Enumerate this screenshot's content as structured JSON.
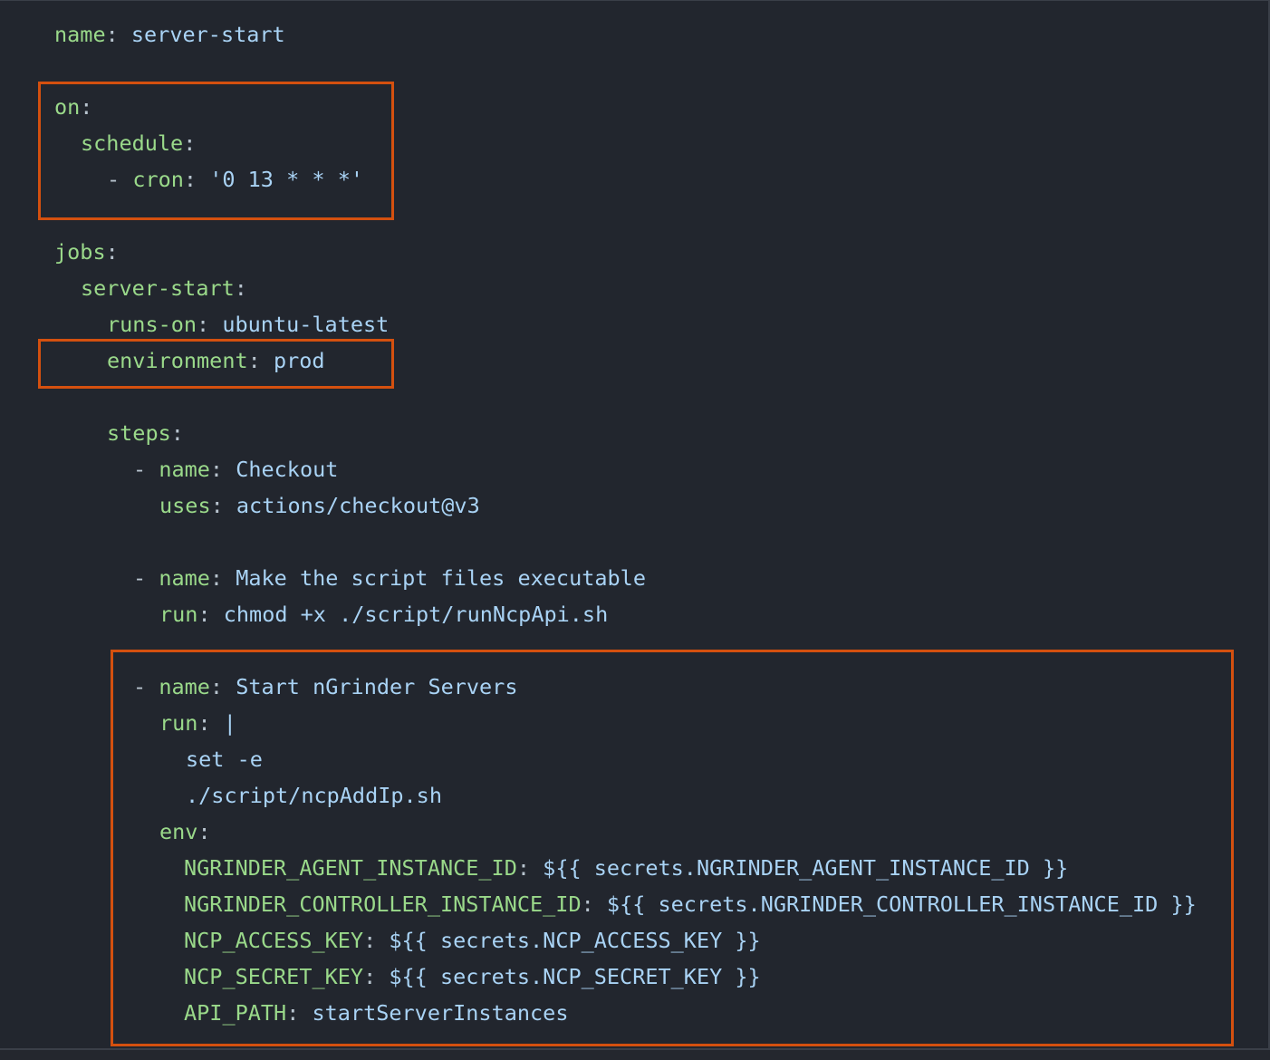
{
  "colors": {
    "background": "#22262e",
    "key": "#9ad98a",
    "value": "#a9d3f5",
    "punctuation": "#b8c4cf",
    "highlight_border": "#d4500f"
  },
  "code": {
    "l1": {
      "key": "name",
      "colon": ":",
      "val": "server-start"
    },
    "l3": {
      "key": "on",
      "colon": ":"
    },
    "l4": {
      "key": "schedule",
      "colon": ":"
    },
    "l5": {
      "dash": "-",
      "key": "cron",
      "colon": ":",
      "val": "'0 13 * * *'"
    },
    "l7": {
      "key": "jobs",
      "colon": ":"
    },
    "l8": {
      "key": "server-start",
      "colon": ":"
    },
    "l9": {
      "key": "runs-on",
      "colon": ":",
      "val": "ubuntu-latest"
    },
    "l10": {
      "key": "environment",
      "colon": ":",
      "val": "prod"
    },
    "l12": {
      "key": "steps",
      "colon": ":"
    },
    "l13": {
      "dash": "-",
      "key": "name",
      "colon": ":",
      "val": "Checkout"
    },
    "l14": {
      "key": "uses",
      "colon": ":",
      "val": "actions/checkout@v3"
    },
    "l16": {
      "dash": "-",
      "key": "name",
      "colon": ":",
      "val": "Make the script files executable"
    },
    "l17": {
      "key": "run",
      "colon": ":",
      "val": "chmod +x ./script/runNcpApi.sh"
    },
    "l19": {
      "dash": "-",
      "key": "name",
      "colon": ":",
      "val": "Start nGrinder Servers"
    },
    "l20": {
      "key": "run",
      "colon": ":",
      "val": "|"
    },
    "l21": {
      "val": "set -e"
    },
    "l22": {
      "val": "./script/ncpAddIp.sh"
    },
    "l23": {
      "key": "env",
      "colon": ":"
    },
    "l24": {
      "key": "NGRINDER_AGENT_INSTANCE_ID",
      "colon": ":",
      "val": "${{ secrets.NGRINDER_AGENT_INSTANCE_ID }}"
    },
    "l25": {
      "key": "NGRINDER_CONTROLLER_INSTANCE_ID",
      "colon": ":",
      "val": "${{ secrets.NGRINDER_CONTROLLER_INSTANCE_ID }}"
    },
    "l26": {
      "key": "NCP_ACCESS_KEY",
      "colon": ":",
      "val": "${{ secrets.NCP_ACCESS_KEY }}"
    },
    "l27": {
      "key": "NCP_SECRET_KEY",
      "colon": ":",
      "val": "${{ secrets.NCP_SECRET_KEY }}"
    },
    "l28": {
      "key": "API_PATH",
      "colon": ":",
      "val": "startServerInstances"
    }
  }
}
